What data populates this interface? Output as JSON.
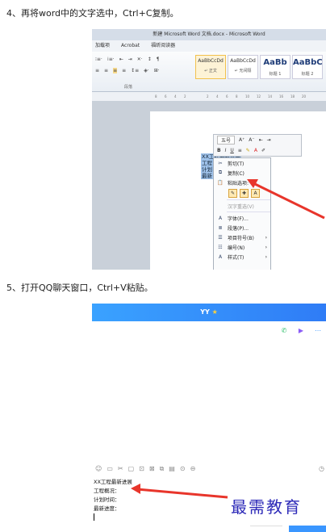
{
  "steps": {
    "step4": "4、再将word中的文字选中，Ctrl+C复制。",
    "step5": "5、打开QQ聊天窗口，Ctrl+V粘贴。"
  },
  "word": {
    "title": "新建 Microsoft Word 文档.docx - Microsoft Word",
    "tabs": [
      "加载项",
      "Acrobat",
      "福昕阅读器"
    ],
    "paragraph_group": "段落",
    "styles": [
      {
        "preview": "AaBbCcDd",
        "name": "↵ 正文"
      },
      {
        "preview": "AaBbCcDd",
        "name": "↵ 无间隔"
      },
      {
        "preview": "AaBb",
        "name": "标题 1"
      },
      {
        "preview": "AaBbC",
        "name": "标题 2"
      }
    ],
    "ruler_ticks": [
      "8",
      "6",
      "4",
      "2",
      "2",
      "4",
      "6",
      "8",
      "10",
      "12",
      "14",
      "16",
      "18",
      "20"
    ],
    "selected_lines": [
      "XX工程最新进展",
      "工程",
      "计划",
      "最新"
    ],
    "mini_toolbar": {
      "font_size": "五号",
      "row2": [
        "B",
        "I",
        "U",
        "≡",
        "A",
        "A"
      ]
    },
    "context_menu": {
      "cut": "剪切(T)",
      "copy": "复制(C)",
      "paste_options": "粘贴选项:",
      "hanzi_reselect": "汉字重选(V)",
      "font": "字体(F)...",
      "paragraph": "段落(P)...",
      "bullets": "项目符号(B)",
      "numbering": "编号(N)",
      "styles": "样式(T)"
    }
  },
  "qq": {
    "contact": "YY",
    "star": "★",
    "pasted_lines": [
      "XX工程最新进展",
      "工程概况：",
      "计划时间：",
      "最新进度："
    ],
    "watermark": "最需教育"
  },
  "colors": {
    "arrow": "#e8352b",
    "qq_header": "#2f7cf6",
    "selection": "#9fc2ea"
  }
}
